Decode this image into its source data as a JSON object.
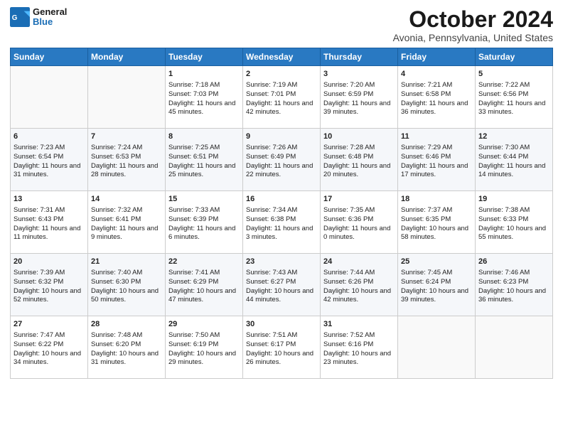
{
  "header": {
    "logo_line1": "General",
    "logo_line2": "Blue",
    "title": "October 2024",
    "subtitle": "Avonia, Pennsylvania, United States"
  },
  "days_of_week": [
    "Sunday",
    "Monday",
    "Tuesday",
    "Wednesday",
    "Thursday",
    "Friday",
    "Saturday"
  ],
  "weeks": [
    [
      {
        "day": "",
        "sunrise": "",
        "sunset": "",
        "daylight": ""
      },
      {
        "day": "",
        "sunrise": "",
        "sunset": "",
        "daylight": ""
      },
      {
        "day": "1",
        "sunrise": "Sunrise: 7:18 AM",
        "sunset": "Sunset: 7:03 PM",
        "daylight": "Daylight: 11 hours and 45 minutes."
      },
      {
        "day": "2",
        "sunrise": "Sunrise: 7:19 AM",
        "sunset": "Sunset: 7:01 PM",
        "daylight": "Daylight: 11 hours and 42 minutes."
      },
      {
        "day": "3",
        "sunrise": "Sunrise: 7:20 AM",
        "sunset": "Sunset: 6:59 PM",
        "daylight": "Daylight: 11 hours and 39 minutes."
      },
      {
        "day": "4",
        "sunrise": "Sunrise: 7:21 AM",
        "sunset": "Sunset: 6:58 PM",
        "daylight": "Daylight: 11 hours and 36 minutes."
      },
      {
        "day": "5",
        "sunrise": "Sunrise: 7:22 AM",
        "sunset": "Sunset: 6:56 PM",
        "daylight": "Daylight: 11 hours and 33 minutes."
      }
    ],
    [
      {
        "day": "6",
        "sunrise": "Sunrise: 7:23 AM",
        "sunset": "Sunset: 6:54 PM",
        "daylight": "Daylight: 11 hours and 31 minutes."
      },
      {
        "day": "7",
        "sunrise": "Sunrise: 7:24 AM",
        "sunset": "Sunset: 6:53 PM",
        "daylight": "Daylight: 11 hours and 28 minutes."
      },
      {
        "day": "8",
        "sunrise": "Sunrise: 7:25 AM",
        "sunset": "Sunset: 6:51 PM",
        "daylight": "Daylight: 11 hours and 25 minutes."
      },
      {
        "day": "9",
        "sunrise": "Sunrise: 7:26 AM",
        "sunset": "Sunset: 6:49 PM",
        "daylight": "Daylight: 11 hours and 22 minutes."
      },
      {
        "day": "10",
        "sunrise": "Sunrise: 7:28 AM",
        "sunset": "Sunset: 6:48 PM",
        "daylight": "Daylight: 11 hours and 20 minutes."
      },
      {
        "day": "11",
        "sunrise": "Sunrise: 7:29 AM",
        "sunset": "Sunset: 6:46 PM",
        "daylight": "Daylight: 11 hours and 17 minutes."
      },
      {
        "day": "12",
        "sunrise": "Sunrise: 7:30 AM",
        "sunset": "Sunset: 6:44 PM",
        "daylight": "Daylight: 11 hours and 14 minutes."
      }
    ],
    [
      {
        "day": "13",
        "sunrise": "Sunrise: 7:31 AM",
        "sunset": "Sunset: 6:43 PM",
        "daylight": "Daylight: 11 hours and 11 minutes."
      },
      {
        "day": "14",
        "sunrise": "Sunrise: 7:32 AM",
        "sunset": "Sunset: 6:41 PM",
        "daylight": "Daylight: 11 hours and 9 minutes."
      },
      {
        "day": "15",
        "sunrise": "Sunrise: 7:33 AM",
        "sunset": "Sunset: 6:39 PM",
        "daylight": "Daylight: 11 hours and 6 minutes."
      },
      {
        "day": "16",
        "sunrise": "Sunrise: 7:34 AM",
        "sunset": "Sunset: 6:38 PM",
        "daylight": "Daylight: 11 hours and 3 minutes."
      },
      {
        "day": "17",
        "sunrise": "Sunrise: 7:35 AM",
        "sunset": "Sunset: 6:36 PM",
        "daylight": "Daylight: 11 hours and 0 minutes."
      },
      {
        "day": "18",
        "sunrise": "Sunrise: 7:37 AM",
        "sunset": "Sunset: 6:35 PM",
        "daylight": "Daylight: 10 hours and 58 minutes."
      },
      {
        "day": "19",
        "sunrise": "Sunrise: 7:38 AM",
        "sunset": "Sunset: 6:33 PM",
        "daylight": "Daylight: 10 hours and 55 minutes."
      }
    ],
    [
      {
        "day": "20",
        "sunrise": "Sunrise: 7:39 AM",
        "sunset": "Sunset: 6:32 PM",
        "daylight": "Daylight: 10 hours and 52 minutes."
      },
      {
        "day": "21",
        "sunrise": "Sunrise: 7:40 AM",
        "sunset": "Sunset: 6:30 PM",
        "daylight": "Daylight: 10 hours and 50 minutes."
      },
      {
        "day": "22",
        "sunrise": "Sunrise: 7:41 AM",
        "sunset": "Sunset: 6:29 PM",
        "daylight": "Daylight: 10 hours and 47 minutes."
      },
      {
        "day": "23",
        "sunrise": "Sunrise: 7:43 AM",
        "sunset": "Sunset: 6:27 PM",
        "daylight": "Daylight: 10 hours and 44 minutes."
      },
      {
        "day": "24",
        "sunrise": "Sunrise: 7:44 AM",
        "sunset": "Sunset: 6:26 PM",
        "daylight": "Daylight: 10 hours and 42 minutes."
      },
      {
        "day": "25",
        "sunrise": "Sunrise: 7:45 AM",
        "sunset": "Sunset: 6:24 PM",
        "daylight": "Daylight: 10 hours and 39 minutes."
      },
      {
        "day": "26",
        "sunrise": "Sunrise: 7:46 AM",
        "sunset": "Sunset: 6:23 PM",
        "daylight": "Daylight: 10 hours and 36 minutes."
      }
    ],
    [
      {
        "day": "27",
        "sunrise": "Sunrise: 7:47 AM",
        "sunset": "Sunset: 6:22 PM",
        "daylight": "Daylight: 10 hours and 34 minutes."
      },
      {
        "day": "28",
        "sunrise": "Sunrise: 7:48 AM",
        "sunset": "Sunset: 6:20 PM",
        "daylight": "Daylight: 10 hours and 31 minutes."
      },
      {
        "day": "29",
        "sunrise": "Sunrise: 7:50 AM",
        "sunset": "Sunset: 6:19 PM",
        "daylight": "Daylight: 10 hours and 29 minutes."
      },
      {
        "day": "30",
        "sunrise": "Sunrise: 7:51 AM",
        "sunset": "Sunset: 6:17 PM",
        "daylight": "Daylight: 10 hours and 26 minutes."
      },
      {
        "day": "31",
        "sunrise": "Sunrise: 7:52 AM",
        "sunset": "Sunset: 6:16 PM",
        "daylight": "Daylight: 10 hours and 23 minutes."
      },
      {
        "day": "",
        "sunrise": "",
        "sunset": "",
        "daylight": ""
      },
      {
        "day": "",
        "sunrise": "",
        "sunset": "",
        "daylight": ""
      }
    ]
  ]
}
